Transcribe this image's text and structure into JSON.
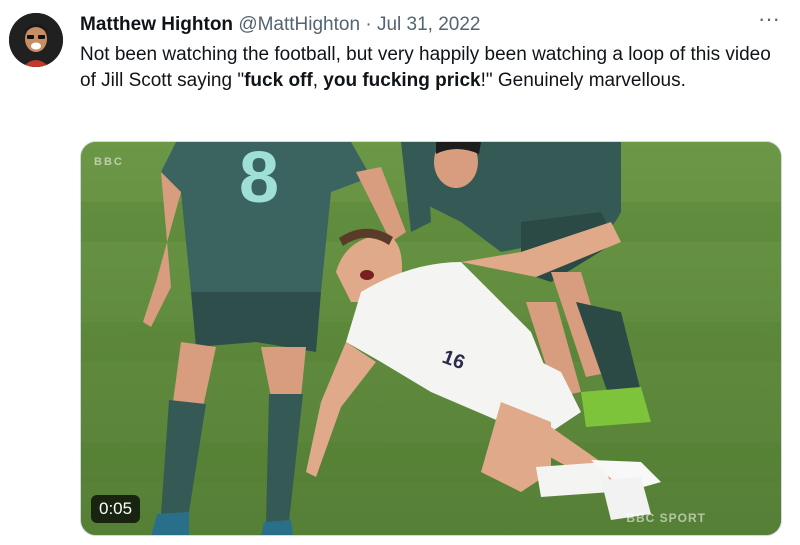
{
  "tweet": {
    "author_name": "Matthew Highton",
    "handle": "@MattHighton",
    "separator": " · ",
    "date": "Jul 31, 2022",
    "more_label": "···",
    "text_parts": {
      "p1": "Not been watching the football, but very happily been watching a loop of this video of Jill Scott saying \"",
      "b1": "fuck off",
      "p2": ", ",
      "b2": "you fucking prick",
      "p3": "!\"  Genuinely marvellous."
    }
  },
  "media": {
    "duration": "0:05",
    "watermark_top": "BBC",
    "watermark_bottom": "BBC SPORT",
    "shirt_number_green": "8",
    "shirt_number_white": "16",
    "colors": {
      "pitch": "#5f8c3d",
      "pitch_dark": "#4e7a30",
      "green_kit": "#355a55",
      "white_kit": "#f4f4f2",
      "skin": "#e0a98a"
    }
  }
}
